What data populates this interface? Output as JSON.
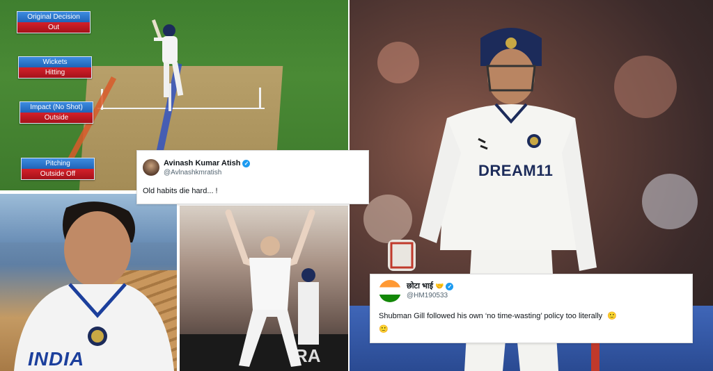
{
  "drs": {
    "original_decision": {
      "label": "Original Decision",
      "value": "Out"
    },
    "wickets": {
      "label": "Wickets",
      "value": "Hitting"
    },
    "impact": {
      "label": "Impact (No Shot)",
      "value": "Outside"
    },
    "pitching": {
      "label": "Pitching",
      "value": "Outside Off"
    }
  },
  "tweet1": {
    "name": "Avinash Kumar Atish",
    "handle": "@Avlnashkmratish",
    "text": "Old habits die hard... !"
  },
  "tweet2": {
    "name": "छोटा भाई",
    "handle": "@HM190533",
    "text": "Shubman Gill followed his own ‘no time-wasting’ policy too literally",
    "emoji": "🙂"
  },
  "jersey": {
    "sponsor": "DREAM11",
    "team": "INDIA"
  },
  "colors": {
    "drs_blue": "#1f63b8",
    "drs_red": "#c41a22",
    "verified_blue": "#1d9bf0",
    "india_navy": "#1c2b5a"
  }
}
